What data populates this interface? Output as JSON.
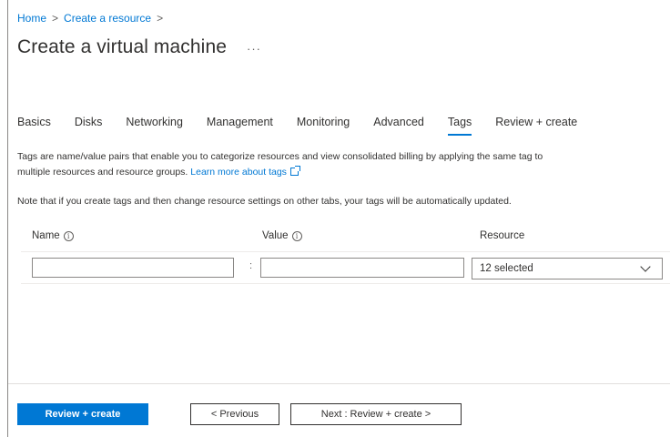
{
  "breadcrumb": {
    "home": "Home",
    "create_resource": "Create a resource",
    "sep": ">"
  },
  "page": {
    "title": "Create a virtual machine",
    "more": "···"
  },
  "tabs": [
    {
      "label": "Basics",
      "active": false
    },
    {
      "label": "Disks",
      "active": false
    },
    {
      "label": "Networking",
      "active": false
    },
    {
      "label": "Management",
      "active": false
    },
    {
      "label": "Monitoring",
      "active": false
    },
    {
      "label": "Advanced",
      "active": false
    },
    {
      "label": "Tags",
      "active": true
    },
    {
      "label": "Review + create",
      "active": false
    }
  ],
  "description": {
    "line1": "Tags are name/value pairs that enable you to categorize resources and view consolidated billing by applying the same tag to",
    "line2": "multiple resources and resource groups.",
    "link": "Learn more about tags"
  },
  "note": "Note that if you create tags and then change resource settings on other tabs, your tags will be automatically updated.",
  "grid": {
    "columns": {
      "name": "Name",
      "value": "Value",
      "resource": "Resource"
    },
    "row": {
      "name_value": "",
      "value_value": "",
      "separator": ":",
      "resource_value": "12 selected"
    }
  },
  "footer": {
    "review_create": "Review + create",
    "previous": "< Previous",
    "next": "Next : Review + create >"
  },
  "colors": {
    "accent": "#0078d4",
    "text": "#323130",
    "border": "#8a8886"
  }
}
